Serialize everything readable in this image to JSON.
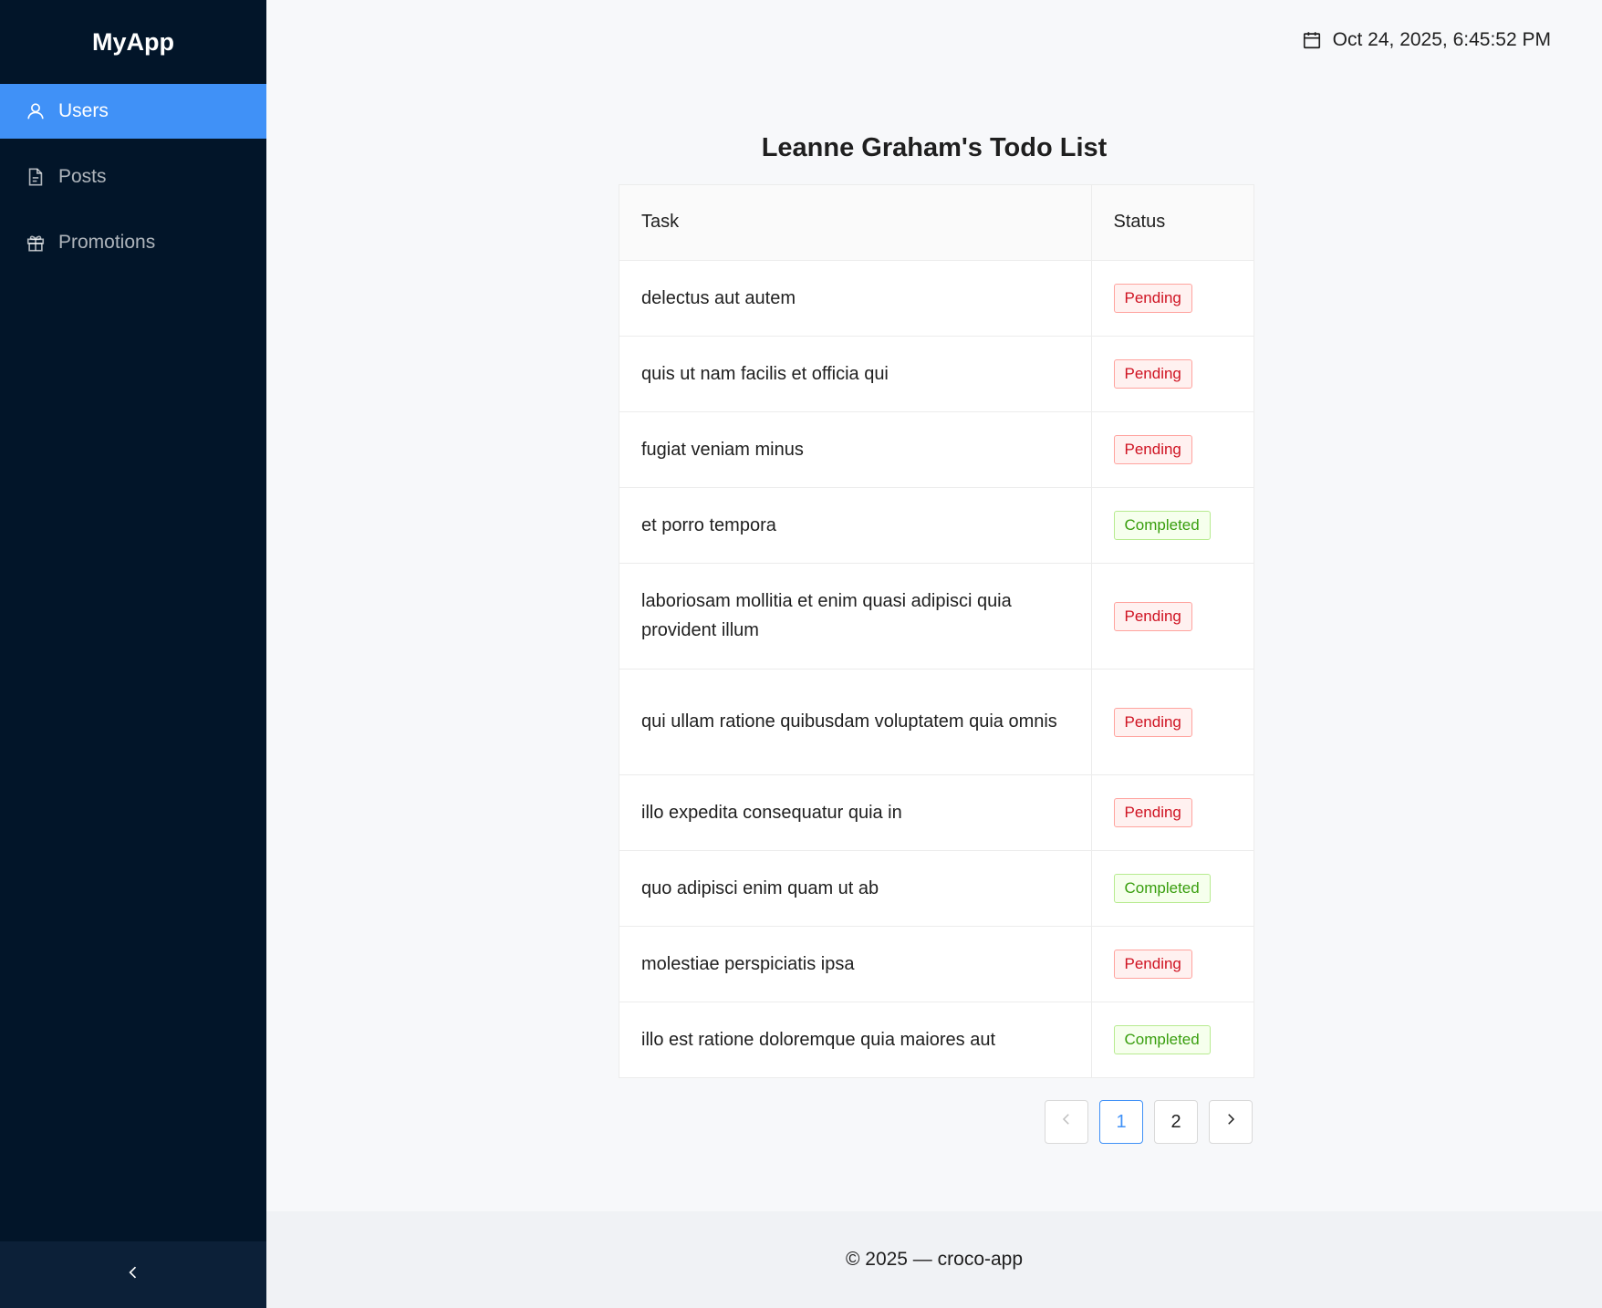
{
  "app": {
    "logo": "MyApp"
  },
  "sidebar": {
    "items": [
      {
        "label": "Users",
        "icon": "user-icon",
        "active": true
      },
      {
        "label": "Posts",
        "icon": "file-icon",
        "active": false
      },
      {
        "label": "Promotions",
        "icon": "gift-icon",
        "active": false
      }
    ],
    "collapse_icon": "chevron-left-icon"
  },
  "header": {
    "datetime": "Oct 24, 2025, 6:45:52 PM",
    "icon": "calendar-icon"
  },
  "main": {
    "title": "Leanne Graham's Todo List",
    "columns": [
      "Task",
      "Status"
    ],
    "rows": [
      {
        "task": "delectus aut autem",
        "status": "Pending"
      },
      {
        "task": "quis ut nam facilis et officia qui",
        "status": "Pending"
      },
      {
        "task": "fugiat veniam minus",
        "status": "Pending"
      },
      {
        "task": "et porro tempora",
        "status": "Completed"
      },
      {
        "task": "laboriosam mollitia et enim quasi adipisci quia provident illum",
        "status": "Pending"
      },
      {
        "task": "qui ullam ratione quibusdam voluptatem quia omnis",
        "status": "Pending"
      },
      {
        "task": "illo expedita consequatur quia in",
        "status": "Pending"
      },
      {
        "task": "quo adipisci enim quam ut ab",
        "status": "Completed"
      },
      {
        "task": "molestiae perspiciatis ipsa",
        "status": "Pending"
      },
      {
        "task": "illo est ratione doloremque quia maiores aut",
        "status": "Completed"
      }
    ]
  },
  "pagination": {
    "pages": [
      "1",
      "2"
    ],
    "current": "1"
  },
  "footer": {
    "text": "© 2025 — croco-app"
  },
  "colors": {
    "sidebar_bg": "#021529",
    "accent": "#4091f7",
    "pending": "#cf1322",
    "completed": "#389e0d"
  }
}
